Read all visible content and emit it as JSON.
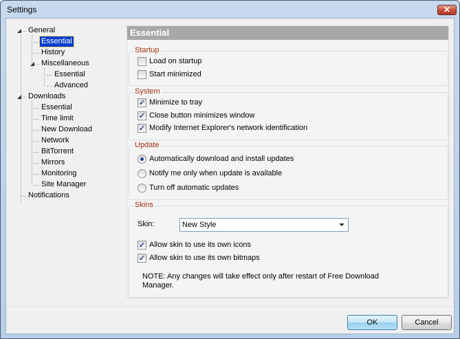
{
  "window": {
    "title": "Settings",
    "close_icon": "close-icon"
  },
  "tree": [
    {
      "label": "General",
      "level": 0,
      "expanded": true
    },
    {
      "label": "Essential",
      "level": 1,
      "selected": true
    },
    {
      "label": "History",
      "level": 1
    },
    {
      "label": "Miscellaneous",
      "level": 1,
      "expanded": true
    },
    {
      "label": "Essential",
      "level": 2
    },
    {
      "label": "Advanced",
      "level": 2
    },
    {
      "label": "Downloads",
      "level": 0,
      "expanded": true
    },
    {
      "label": "Essential",
      "level": 1
    },
    {
      "label": "Time limit",
      "level": 1
    },
    {
      "label": "New Download",
      "level": 1
    },
    {
      "label": "Network",
      "level": 1
    },
    {
      "label": "BitTorrent",
      "level": 1
    },
    {
      "label": "Mirrors",
      "level": 1
    },
    {
      "label": "Monitoring",
      "level": 1
    },
    {
      "label": "Site Manager",
      "level": 1
    },
    {
      "label": "Notifications",
      "level": 0
    }
  ],
  "panel": {
    "title": "Essential",
    "startup": {
      "label": "Startup",
      "items": [
        {
          "label": "Load on startup",
          "checked": false
        },
        {
          "label": "Start minimized",
          "checked": false
        }
      ]
    },
    "system": {
      "label": "System",
      "items": [
        {
          "label": "Minimize to tray",
          "checked": true
        },
        {
          "label": "Close button minimizes window",
          "checked": true
        },
        {
          "label": "Modify Internet Explorer's network identification",
          "checked": true
        }
      ]
    },
    "update": {
      "label": "Update",
      "options": [
        {
          "label": "Automatically download and install updates",
          "selected": true
        },
        {
          "label": "Notify me only when update is available",
          "selected": false
        },
        {
          "label": "Turn off automatic updates",
          "selected": false
        }
      ]
    },
    "skins": {
      "label": "Skins",
      "skin_label": "Skin:",
      "skin_value": "New Style",
      "items": [
        {
          "label": "Allow skin to use its own icons",
          "checked": true
        },
        {
          "label": "Allow skin to use its own bitmaps",
          "checked": true
        }
      ],
      "note": "NOTE: Any changes will take effect only after restart of Free Download Manager."
    }
  },
  "buttons": {
    "ok": "OK",
    "cancel": "Cancel"
  }
}
